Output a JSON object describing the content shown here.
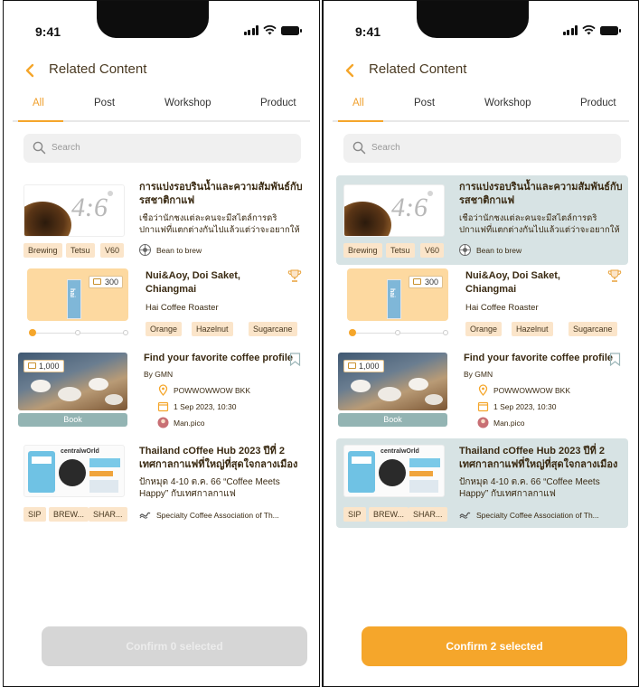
{
  "screens": [
    {
      "time": "9:41",
      "header": {
        "title": "Related Content"
      },
      "tabs": [
        "All",
        "Post",
        "Workshop",
        "Product"
      ],
      "search": {
        "placeholder": "Search"
      },
      "cards": [
        {
          "type": "post",
          "selected": false,
          "title": "การแบ่งรอบรินน้ำและความสัมพันธ์กับรสชาติกาแฟ",
          "desc": "เชื่อว่านักชงแต่ละคนจะมีสไตล์การดริปกาแฟที่แตกต่างกันไปแล้วแต่ว่าจะอยากให้กาแฟ...",
          "thumb_text": "4:6",
          "tags": [
            "Brewing",
            "Tetsu",
            "V60"
          ],
          "author": "Bean to brew"
        },
        {
          "type": "product",
          "selected": false,
          "price": "300",
          "title": "Nui&Aoy, Doi Saket, Chiangmai",
          "roaster": "Hai Coffee Roaster",
          "tags": [
            "Orange",
            "Hazelnut",
            "Sugarcane"
          ],
          "thumb_text": "hai"
        },
        {
          "type": "workshop",
          "selected": false,
          "price": "1,000",
          "title": "Find your favorite coffee profile",
          "by": "By GMN",
          "location": "POWWOWWOW BKK",
          "date": "1 Sep 2023, 10:30",
          "host": "Man.pico",
          "button": "Book"
        },
        {
          "type": "post",
          "selected": false,
          "title": "Thailand cOffee Hub 2023 ปีที่ 2 เทศกาลกาแฟที่ใหญ่ที่สุดใจกลางเมือง",
          "desc": "ปักหมุด 4-10 ต.ค. 66 “Coffee Meets Happy” กับเทศกาลกาแฟ",
          "thumb_text": "centralwOrld",
          "tags": [
            "SIP",
            "BREW...",
            "SHAR..."
          ],
          "author": "Specialty Coffee Association of Th..."
        }
      ],
      "confirm": {
        "label": "Confirm 0 selected",
        "enabled": false
      }
    },
    {
      "time": "9:41",
      "header": {
        "title": "Related Content"
      },
      "tabs": [
        "All",
        "Post",
        "Workshop",
        "Product"
      ],
      "search": {
        "placeholder": "Search"
      },
      "cards": [
        {
          "type": "post",
          "selected": true,
          "title": "การแบ่งรอบรินน้ำและความสัมพันธ์กับรสชาติกาแฟ",
          "desc": "เชื่อว่านักชงแต่ละคนจะมีสไตล์การดริปกาแฟที่แตกต่างกันไปแล้วแต่ว่าจะอยากให้กาแฟ...",
          "thumb_text": "4:6",
          "tags": [
            "Brewing",
            "Tetsu",
            "V60"
          ],
          "author": "Bean to brew"
        },
        {
          "type": "product",
          "selected": false,
          "price": "300",
          "title": "Nui&Aoy, Doi Saket, Chiangmai",
          "roaster": "Hai Coffee Roaster",
          "tags": [
            "Orange",
            "Hazelnut",
            "Sugarcane"
          ],
          "thumb_text": "hai"
        },
        {
          "type": "workshop",
          "selected": false,
          "price": "1,000",
          "title": "Find your favorite coffee profile",
          "by": "By GMN",
          "location": "POWWOWWOW BKK",
          "date": "1 Sep 2023, 10:30",
          "host": "Man.pico",
          "button": "Book"
        },
        {
          "type": "post",
          "selected": true,
          "title": "Thailand cOffee Hub 2023 ปีที่ 2 เทศกาลกาแฟที่ใหญ่ที่สุดใจกลางเมือง",
          "desc": "ปักหมุด 4-10 ต.ค. 66 “Coffee Meets Happy” กับเทศกาลกาแฟ",
          "thumb_text": "centralwOrld",
          "tags": [
            "SIP",
            "BREW...",
            "SHAR..."
          ],
          "author": "Specialty Coffee Association of Th..."
        }
      ],
      "confirm": {
        "label": "Confirm 2 selected",
        "enabled": true
      }
    }
  ],
  "colors": {
    "accent": "#f5a62b",
    "selected_bg": "#d7e3e4",
    "chip_bg": "#fbe5ca",
    "book_button": "#93b4b3",
    "disabled": "#d6d6d6"
  }
}
